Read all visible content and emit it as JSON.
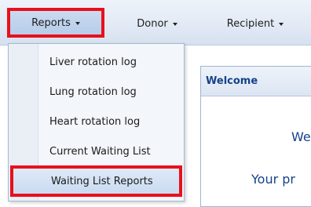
{
  "menubar": {
    "items": [
      {
        "label": "Reports",
        "icon": "chevron-down-icon",
        "highlighted": true
      },
      {
        "label": "Donor",
        "icon": "chevron-down-icon"
      },
      {
        "label": "Recipient",
        "icon": "chevron-down-icon"
      }
    ]
  },
  "reports_menu": {
    "items": [
      {
        "label": "Liver rotation log"
      },
      {
        "label": "Lung rotation log"
      },
      {
        "label": "Heart rotation log"
      },
      {
        "label": "Current Waiting List"
      },
      {
        "label": "Waiting List Reports",
        "selected": true
      }
    ]
  },
  "welcome_panel": {
    "title": "Welcome",
    "line1": "We",
    "line2": "Your pr"
  },
  "colors": {
    "highlight_border": "#e8101c",
    "header_text": "#15428b"
  }
}
